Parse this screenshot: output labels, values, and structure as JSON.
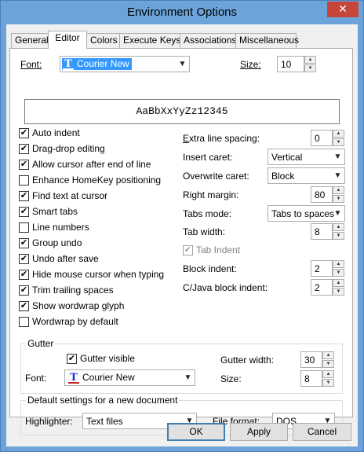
{
  "window": {
    "title": "Environment Options",
    "close_glyph": "✕"
  },
  "tabs": [
    {
      "label": "General",
      "active": false
    },
    {
      "label": "Editor",
      "active": true
    },
    {
      "label": "Colors",
      "active": false
    },
    {
      "label": "Execute Keys",
      "active": false
    },
    {
      "label": "Associations",
      "active": false
    },
    {
      "label": "Miscellaneous",
      "active": false
    }
  ],
  "font_row": {
    "font_label": "Font:",
    "font_value": "Courier New",
    "font_icon": "T",
    "size_label": "Size:",
    "size_value": "10"
  },
  "preview_text": "AaBbXxYyZz12345",
  "checkboxes": [
    {
      "label": "Auto indent",
      "checked": true
    },
    {
      "label": "Drag-drop editing",
      "checked": true
    },
    {
      "label": "Allow cursor after end of line",
      "checked": true
    },
    {
      "label": "Enhance HomeKey positioning",
      "checked": false
    },
    {
      "label": "Find text at cursor",
      "checked": true
    },
    {
      "label": "Smart tabs",
      "checked": true
    },
    {
      "label": "Line numbers",
      "checked": false
    },
    {
      "label": "Group undo",
      "checked": true
    },
    {
      "label": "Undo after save",
      "checked": true
    },
    {
      "label": "Hide mouse cursor when typing",
      "checked": true
    },
    {
      "label": "Trim trailing spaces",
      "checked": true
    },
    {
      "label": "Show wordwrap glyph",
      "checked": true
    },
    {
      "label": "Wordwrap by default",
      "checked": false
    }
  ],
  "right": {
    "extra_line_spacing_label": "Extra line spacing:",
    "extra_line_spacing_value": "0",
    "insert_caret_label": "Insert caret:",
    "insert_caret_value": "Vertical",
    "overwrite_caret_label": "Overwrite caret:",
    "overwrite_caret_value": "Block",
    "right_margin_label": "Right margin:",
    "right_margin_value": "80",
    "tabs_mode_label": "Tabs mode:",
    "tabs_mode_value": "Tabs to spaces",
    "tab_width_label": "Tab width:",
    "tab_width_value": "8",
    "tab_indent_label": "Tab Indent",
    "tab_indent_checked": true,
    "block_indent_label": "Block indent:",
    "block_indent_value": "2",
    "cjava_block_indent_label": "C/Java block indent:",
    "cjava_block_indent_value": "2"
  },
  "gutter": {
    "caption": "Gutter",
    "visible_label": "Gutter visible",
    "visible_checked": true,
    "font_label": "Font:",
    "font_value": "Courier New",
    "width_label": "Gutter width:",
    "width_value": "30",
    "size_label": "Size:",
    "size_value": "8"
  },
  "defaults": {
    "caption": "Default settings for a new document",
    "highlighter_label": "Highlighter:",
    "highlighter_value": "Text files",
    "file_format_label": "File format:",
    "file_format_value": "DOS"
  },
  "buttons": {
    "ok": "OK",
    "apply": "Apply",
    "cancel": "Cancel"
  },
  "glyphs": {
    "check": "✔",
    "combo_arrow": "▼",
    "spin_up": "▲",
    "spin_down": "▼"
  }
}
